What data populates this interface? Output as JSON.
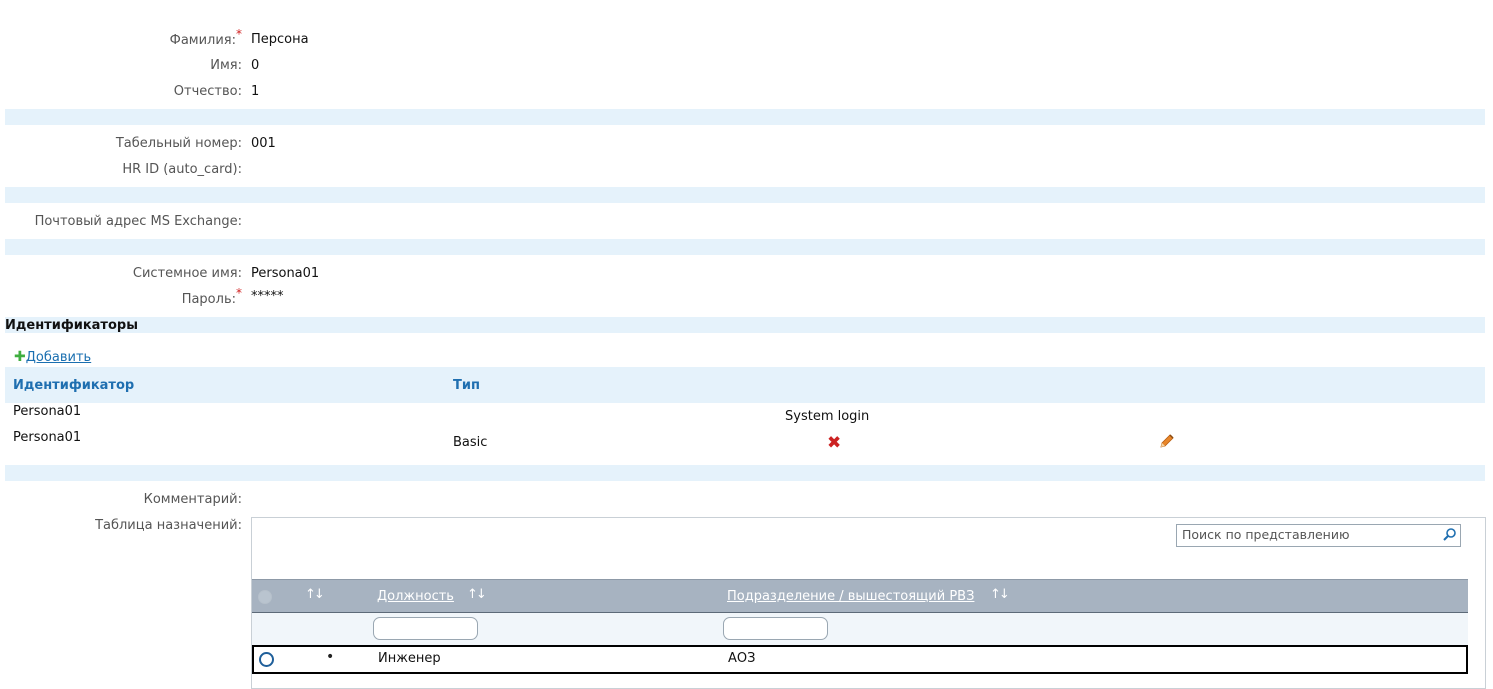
{
  "person": {
    "last_name_label": "Фамилия:",
    "last_name_value": "Персона",
    "first_name_label": "Имя:",
    "first_name_value": "0",
    "middle_name_label": "Отчество:",
    "middle_name_value": "1",
    "required_mark": "*"
  },
  "employment": {
    "tab_number_label": "Табельный номер:",
    "tab_number_value": "001",
    "hr_id_label": "HR ID (auto_card):",
    "hr_id_value": ""
  },
  "mail": {
    "exchange_label": "Почтовый адрес MS Exchange:",
    "exchange_value": ""
  },
  "account": {
    "system_name_label": "Системное имя:",
    "system_name_value": "Persona01",
    "password_label": "Пароль:",
    "password_value": "*****"
  },
  "identifiers": {
    "section_title": "Идентификаторы",
    "add_icon": "plus-icon",
    "add_label": "Добавить",
    "columns": [
      "Идентификатор",
      "Тип"
    ],
    "rows": [
      {
        "identifier": "Persona01",
        "type": "",
        "extra": "System login"
      },
      {
        "identifier": "Persona01",
        "type": "Basic"
      }
    ],
    "delete_icon": "close-icon",
    "edit_icon": "pencil-icon"
  },
  "comment": {
    "label": "Комментарий:",
    "value": ""
  },
  "assignments": {
    "label": "Таблица назначений:",
    "search_placeholder": "Поиск по представлению",
    "search_icon": "search-icon",
    "sort_icon": "↑↓",
    "columns": [
      "Должность",
      "Подразделение / вышестоящий РВЗ"
    ],
    "rows": [
      {
        "bullet": "•",
        "position": "Инженер",
        "department": "АОЗ"
      }
    ]
  },
  "colors": {
    "band": "#e5f2fb",
    "header_text": "#1f6fb0",
    "grid_header": "#a7b3c1",
    "required": "#d02020",
    "delete": "#cc2222",
    "edit": "#e8862a",
    "add": "#3fae3f"
  }
}
